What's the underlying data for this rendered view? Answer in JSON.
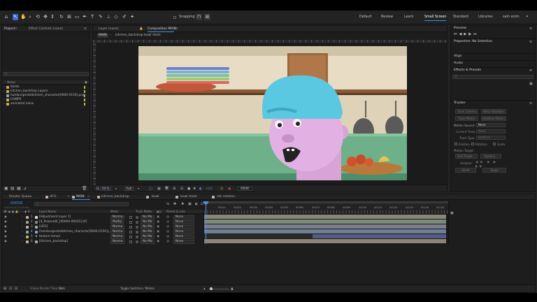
{
  "toolbar": {
    "snapping_label": "Snapping",
    "workspaces": [
      "Default",
      "Review",
      "Learn",
      "Small Screen",
      "Standard",
      "Libraries",
      "sam anim"
    ],
    "active_workspace": "Small Screen"
  },
  "project_panel": {
    "tabs": [
      "Project",
      "Effect Controls (none)"
    ],
    "search_placeholder": "Q",
    "name_header": "Name",
    "items": [
      {
        "label": "Solids",
        "color": "#c8b54a"
      },
      {
        "label": "kitchen_backdrop Layers",
        "color": "#c8b54a"
      },
      {
        "label": "hamburgerdotkitchen_character[0000-0150].png",
        "color": "#8aa6c6"
      },
      {
        "label": "COMPS",
        "color": "#c8b54a"
      },
      {
        "label": "animated noise",
        "color": "#c8b54a"
      }
    ]
  },
  "viewer": {
    "tabs": [
      "Layer (none)",
      "Composition MAIN"
    ],
    "breadcrumbs": [
      "MAIN",
      "kitchen_backdrop",
      "bowl stack"
    ],
    "zoom": "50 %",
    "resolution": "Full",
    "exposure": "+0.0",
    "timecode": "00000"
  },
  "right_panel": {
    "preview_title": "Preview",
    "properties_title": "Properties: No Selection",
    "align_title": "Align",
    "audio_title": "Audio",
    "effects_title": "Effects & Presets",
    "effects_search_placeholder": "Q",
    "tracker": {
      "title": "Tracker",
      "buttons": [
        "Track Camera",
        "Warp Stabilizer",
        "Track Motion",
        "Stabilize Motion"
      ],
      "motion_source_label": "Motion Source:",
      "motion_source_value": "None",
      "current_track_label": "Current Track:",
      "current_track_value": "None",
      "track_type_label": "Track Type:",
      "track_type_value": "Stabilize",
      "checkboxes": [
        "Position",
        "Rotation",
        "Scale"
      ],
      "motion_target_label": "Motion Target:",
      "edit_target": "Edit Target...",
      "options": "Options...",
      "analyze_label": "Analyze:",
      "reset": "Reset",
      "apply": "Apply"
    }
  },
  "timeline": {
    "tabs": [
      "Render Queue",
      "UFO",
      "MAIN",
      "kitchen_backdrop",
      "bowl",
      "bowl stack",
      "ufo rotation"
    ],
    "active_tab": "MAIN",
    "timecode": "00000",
    "fps_note": "0:00:00:00 (24.00 fps)",
    "search_placeholder": "Q",
    "headers": {
      "layer_name": "Layer Name",
      "mode": "Mode",
      "trkmat": "Track Matte",
      "parent": "Parent & Link"
    },
    "ruler": [
      "00010",
      "00020",
      "00030",
      "00040",
      "00050",
      "00060",
      "00070",
      "00080",
      "00090",
      "00100",
      "00110",
      "00120",
      "00130",
      "00140",
      "00150"
    ],
    "layers": [
      {
        "num": "1",
        "name": "[Adjustment Layer 1]",
        "mode": "Norma",
        "matte": "No Ma",
        "parent": "None",
        "color": "#c8b0a0",
        "bar": "#8a8577"
      },
      {
        "num": "2",
        "name": "[4_PolaroidX_[00000-00025].tif]",
        "mode": "Multip",
        "matte": "No Ma",
        "parent": "None",
        "color": "#9aa68e",
        "bar": "#7c8a7a"
      },
      {
        "num": "3",
        "name": "[UFO]",
        "mode": "Norma",
        "matte": "No Ma",
        "parent": "None",
        "color": "#c8b0a0",
        "bar": "#7d7f8c"
      },
      {
        "num": "4",
        "name": "[hamburgerdotkitchen_character[0000-0150].png]",
        "mode": "Norma",
        "matte": "No Ma",
        "parent": "None",
        "color": "#8aa6c6",
        "bar": "#6d7f92"
      },
      {
        "num": "5",
        "name": "texture lemon",
        "mode": "Norma",
        "matte": "No Ma",
        "parent": "None",
        "color": "#c8b54a",
        "bar": "#585a86"
      },
      {
        "num": "6",
        "name": "[kitchen_backdrop]",
        "mode": "Norma",
        "matte": "No Ma",
        "parent": "None",
        "color": "#c8b0a0",
        "bar": "#8a8577"
      }
    ],
    "footer_render_label": "Frame Render Time:",
    "footer_render_value": "0ms",
    "footer_toggle": "Toggle Switches / Modes"
  },
  "colors": {
    "accent_blue": "#3d8ae6",
    "playhead": "#4a90e2",
    "scene_wall": "#e8dcc4",
    "scene_counter": "#6db08a",
    "hair": "#5ac8e0",
    "skin": "#d8a4d8"
  }
}
